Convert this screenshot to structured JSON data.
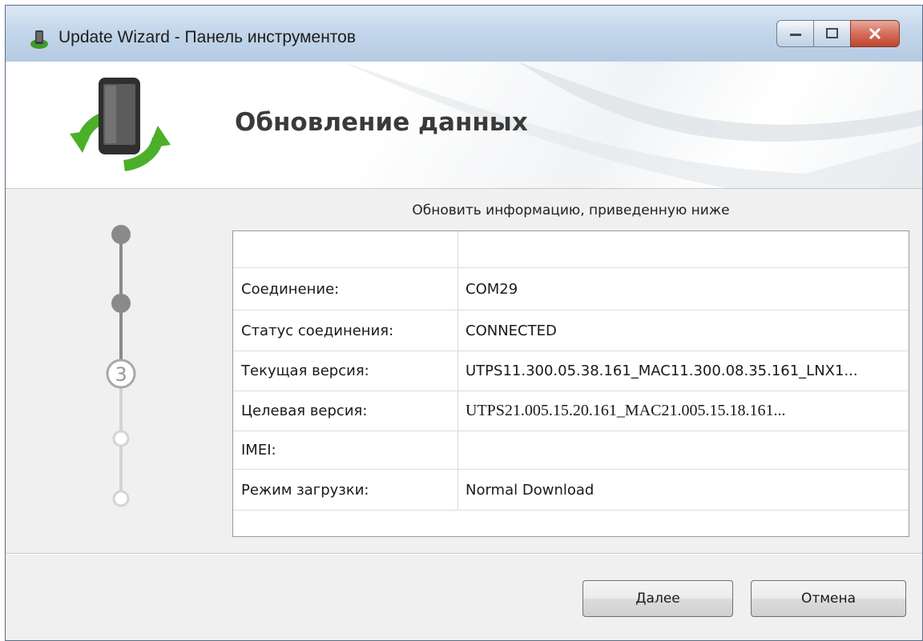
{
  "window": {
    "title": "Update Wizard - Панель инструментов"
  },
  "header": {
    "heading": "Обновление данных"
  },
  "steps": {
    "current_step": "3",
    "total": 5,
    "completed": 2
  },
  "main": {
    "instruction": "Обновить информацию, приведенную ниже",
    "rows": [
      {
        "label": "",
        "value": ""
      },
      {
        "label": "Соединение:",
        "value": "COM29"
      },
      {
        "label": "Статус соединения:",
        "value": "CONNECTED"
      },
      {
        "label": "Текущая версия:",
        "value": "UTPS11.300.05.38.161_MAC11.300.08.35.161_LNX1..."
      },
      {
        "label": "Целевая версия:",
        "value": "UTPS21.005.15.20.161_MAC21.005.15.18.161..."
      },
      {
        "label": "IMEI:",
        "value": ""
      },
      {
        "label": "Режим загрузки:",
        "value": "Normal Download"
      }
    ]
  },
  "footer": {
    "next_label": "Далее",
    "cancel_label": "Отмена"
  },
  "colors": {
    "step_done": "#8a8a8a",
    "step_pending": "#d4d4d4",
    "logo_green": "#4caf2a"
  },
  "icons": {
    "app": "phone-sync-icon",
    "logo": "phone-sync-logo-icon"
  }
}
